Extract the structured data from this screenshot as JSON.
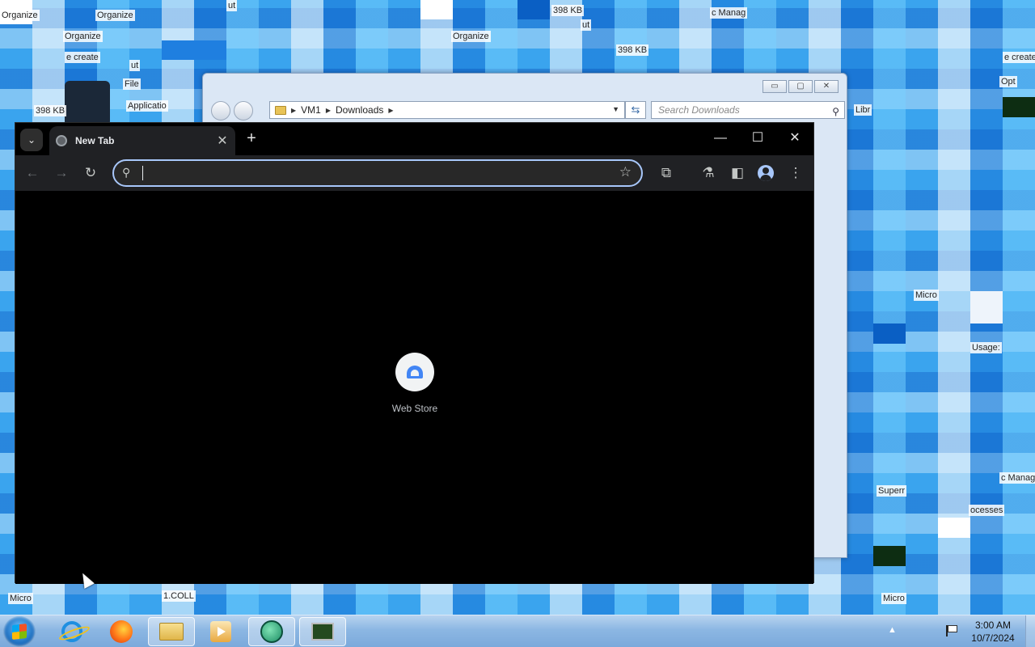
{
  "desktop": {
    "fragments": [
      "Organize",
      "Organize",
      "Organize",
      "Organize",
      "e create",
      "e create",
      "398 KB",
      "398 KB",
      "398 KB",
      "ut",
      "ut",
      "ut",
      "Micro",
      "Micro",
      "Micro",
      "1.COLL",
      "Usage:",
      "ocesses",
      "Superr",
      "Libr",
      "c Manag",
      "c Manag",
      "Applicatio",
      "File",
      "Opt"
    ]
  },
  "explorer": {
    "breadcrumb": [
      "VM1",
      "Downloads"
    ],
    "search_placeholder": "Search Downloads",
    "caption_min": "▭",
    "caption_max": "▢",
    "caption_close": "✕"
  },
  "chrome": {
    "tab_title": "New Tab",
    "tab_close": "✕",
    "new_tab": "+",
    "minimize": "—",
    "maximize": "☐",
    "close": "✕",
    "omnibox_value": "",
    "shortcut_label": "Web Store"
  },
  "taskbar": {
    "apps": [
      "internet-explorer",
      "firefox",
      "windows-explorer",
      "media-player",
      "chat-app",
      "task-manager"
    ],
    "clock_time": "3:00 AM",
    "clock_date": "10/7/2024"
  },
  "colors": {
    "chrome_bg": "#000000",
    "toolbar": "#202124",
    "omnibox_focus": "#a8c7fa",
    "desktop": "#3aa4ee"
  }
}
